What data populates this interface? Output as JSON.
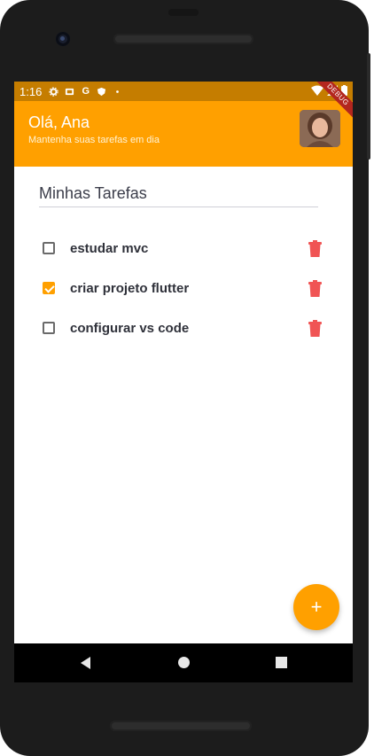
{
  "status_bar": {
    "time": "1:16",
    "icons": [
      "settings-icon",
      "sim-card-icon",
      "google-icon",
      "shield-icon",
      "dot-icon"
    ],
    "right_icons": [
      "wifi-icon",
      "signal-icon",
      "battery-icon"
    ],
    "color": "#c57d00"
  },
  "app_bar": {
    "greeting": "Olá, Ana",
    "subtitle": "Mantenha suas tarefas em dia",
    "debug_banner": "DEBUG",
    "color": "#ffa000"
  },
  "main": {
    "title": "Minhas Tarefas",
    "tasks": [
      {
        "label": "estudar mvc",
        "done": false
      },
      {
        "label": "criar projeto flutter",
        "done": true
      },
      {
        "label": "configurar vs code",
        "done": false
      }
    ]
  },
  "fab": {
    "label": "+",
    "color": "#ffa000"
  },
  "accent_delete_color": "#f05454"
}
